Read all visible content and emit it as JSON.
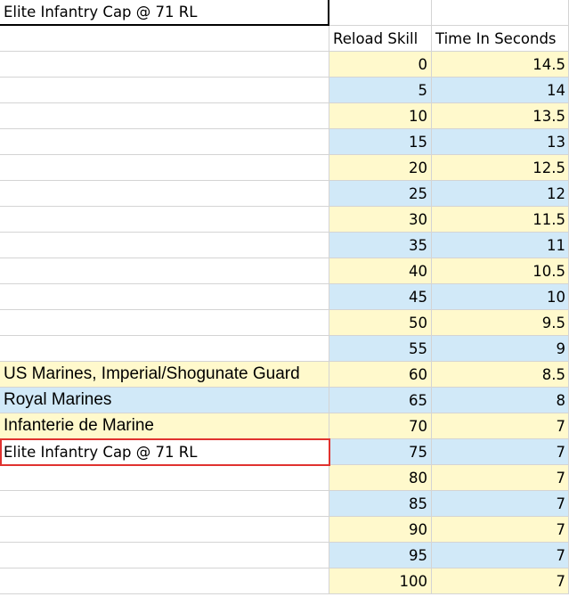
{
  "title_cell": "Elite Infantry Cap @ 71 RL",
  "headers": {
    "reload_skill": "Reload Skill",
    "time_in_seconds": "Time In Seconds"
  },
  "colors": {
    "yellow": "#fff9cc",
    "blue": "#d1e9f8",
    "grid": "#d4d4d4",
    "highlight_border": "#e0322f"
  },
  "rows": [
    {
      "label": "",
      "skill": "0",
      "time": "14.5",
      "band": "yellow"
    },
    {
      "label": "",
      "skill": "5",
      "time": "14",
      "band": "blue"
    },
    {
      "label": "",
      "skill": "10",
      "time": "13.5",
      "band": "yellow"
    },
    {
      "label": "",
      "skill": "15",
      "time": "13",
      "band": "blue"
    },
    {
      "label": "",
      "skill": "20",
      "time": "12.5",
      "band": "yellow"
    },
    {
      "label": "",
      "skill": "25",
      "time": "12",
      "band": "blue"
    },
    {
      "label": "",
      "skill": "30",
      "time": "11.5",
      "band": "yellow"
    },
    {
      "label": "",
      "skill": "35",
      "time": "11",
      "band": "blue"
    },
    {
      "label": "",
      "skill": "40",
      "time": "10.5",
      "band": "yellow"
    },
    {
      "label": "",
      "skill": "45",
      "time": "10",
      "band": "blue"
    },
    {
      "label": "",
      "skill": "50",
      "time": "9.5",
      "band": "yellow"
    },
    {
      "label": "",
      "skill": "55",
      "time": "9",
      "band": "blue"
    },
    {
      "label": "US Marines, Imperial/Shogunate Guard",
      "skill": "60",
      "time": "8.5",
      "band": "yellow",
      "label_band": "yellow"
    },
    {
      "label": "Royal Marines",
      "skill": "65",
      "time": "8",
      "band": "blue",
      "label_band": "blue"
    },
    {
      "label": "Infanterie de Marine",
      "skill": "70",
      "time": "7",
      "band": "yellow",
      "label_band": "yellow"
    },
    {
      "label": "Elite Infantry Cap @ 71 RL",
      "skill": "75",
      "time": "7",
      "band": "blue",
      "highlight": true
    },
    {
      "label": "",
      "skill": "80",
      "time": "7",
      "band": "yellow"
    },
    {
      "label": "",
      "skill": "85",
      "time": "7",
      "band": "blue"
    },
    {
      "label": "",
      "skill": "90",
      "time": "7",
      "band": "yellow"
    },
    {
      "label": "",
      "skill": "95",
      "time": "7",
      "band": "blue"
    },
    {
      "label": "",
      "skill": "100",
      "time": "7",
      "band": "yellow"
    }
  ]
}
